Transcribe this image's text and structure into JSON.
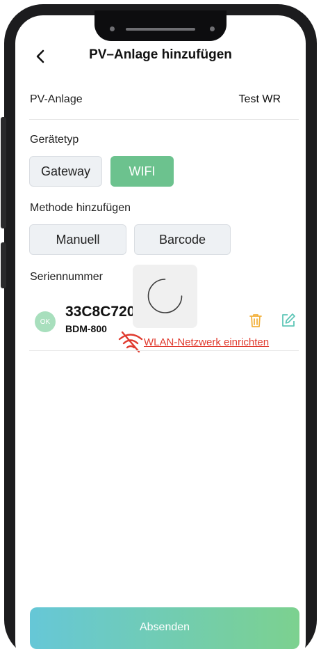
{
  "header": {
    "title": "PV–Anlage hinzufügen"
  },
  "pv_anlage": {
    "label": "PV-Anlage",
    "value": "Test WR"
  },
  "geraetetyp": {
    "label": "Gerätetyp",
    "options": [
      "Gateway",
      "WIFI"
    ],
    "selected": "WIFI"
  },
  "methode": {
    "label": "Methode hinzufügen",
    "options": [
      "Manuell",
      "Barcode"
    ]
  },
  "seriennummer": {
    "label": "Seriennummer",
    "device": {
      "status": "OK",
      "serial": "33C8C720",
      "model": "BDM-800"
    }
  },
  "wlan": {
    "link_text": "WLAN-Netzwerk einrichten"
  },
  "submit": {
    "label": "Absenden"
  },
  "icons": {
    "back": "chevron-left-icon",
    "trash": "trash-icon",
    "edit": "edit-icon",
    "wifi_off": "wifi-off-icon",
    "loading": "spinner-icon"
  },
  "colors": {
    "accent_green": "#6cc28e",
    "link_red": "#e03a2e",
    "trash_orange": "#f2b13c",
    "edit_teal": "#5ec6b7"
  }
}
